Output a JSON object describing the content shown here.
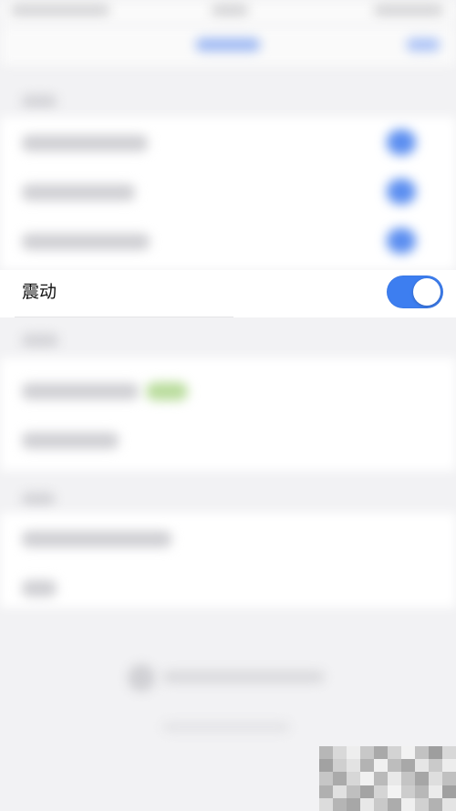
{
  "settings": {
    "vibration": {
      "label": "震动",
      "enabled": true
    }
  },
  "colors": {
    "accent": "#3d7ef0",
    "background": "#f2f2f4",
    "card": "#ffffff",
    "badge": "#b9dc9c"
  }
}
